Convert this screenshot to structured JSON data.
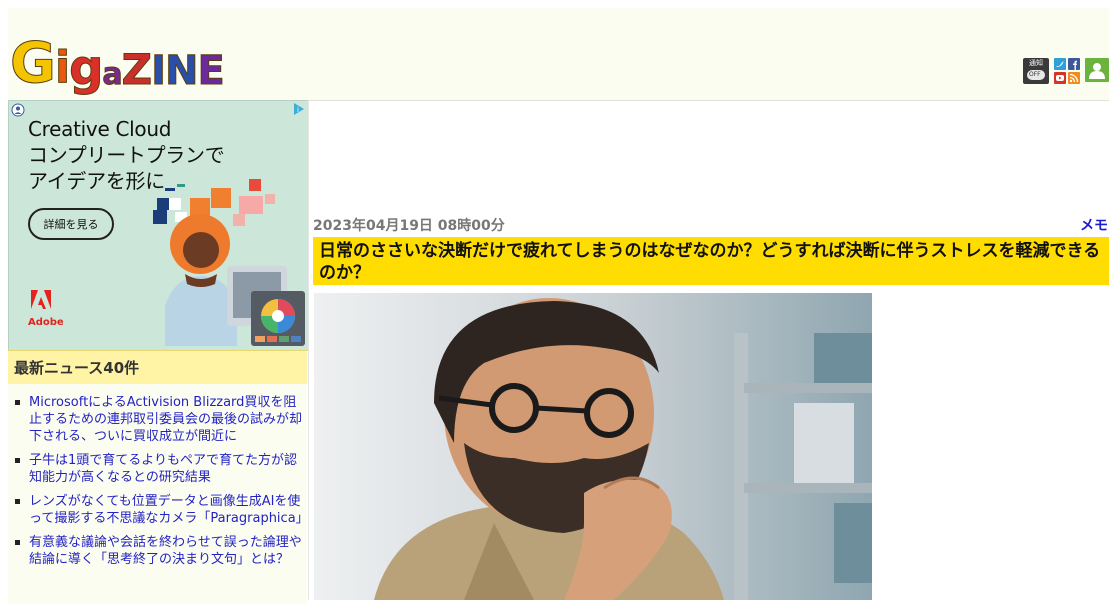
{
  "header": {
    "logo_letters": [
      "G",
      "i",
      "g",
      "a",
      "Z",
      "I",
      "N",
      "E"
    ],
    "notification": {
      "label": "通知",
      "state": "OFF"
    },
    "icons": [
      "twitter-icon",
      "facebook-icon",
      "youtube-icon",
      "rss-icon",
      "user-icon"
    ]
  },
  "ad": {
    "title_lines": [
      "Creative Cloud",
      "コンプリートプランで",
      "アイデアを形に"
    ],
    "cta": "詳細を見る",
    "brand": "Adobe"
  },
  "sidebar": {
    "news_heading": "最新ニュース40件",
    "news": [
      "MicrosoftによるActivision Blizzard買収を阻止するための連邦取引委員会の最後の試みが却下される、ついに買収成立が間近に",
      "子牛は1頭で育てるよりもペアで育てた方が認知能力が高くなるとの研究結果",
      "レンズがなくても位置データと画像生成AIを使って撮影する不思議なカメラ「Paragraphica」",
      "有意義な議論や会話を終わらせて誤った論理や結論に導く「思考終了の決まり文句」とは？"
    ]
  },
  "article": {
    "date": "2023年04月19日 08時00分",
    "category": "メモ",
    "title": "日常のささいな決断だけで疲れてしまうのはなぜなのか？どうすれば決断に伴うストレスを軽減できるのか？"
  }
}
